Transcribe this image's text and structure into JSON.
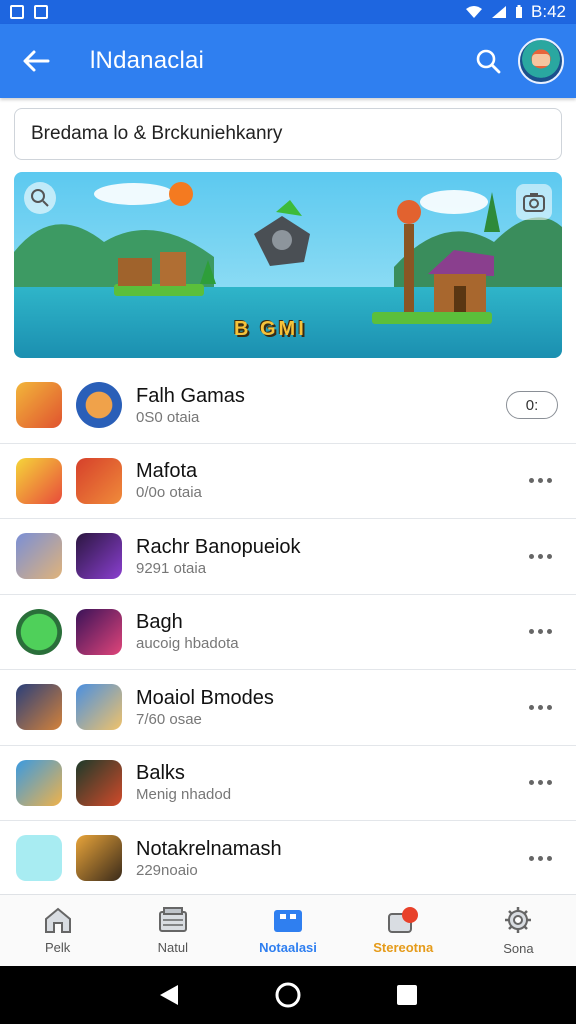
{
  "status_bar": {
    "time": "B:42"
  },
  "app_bar": {
    "title": "lNdanaclai"
  },
  "search": {
    "value": "Bredama lo & Brckuniehkanry"
  },
  "banner": {
    "caption": "B GMI"
  },
  "games": [
    {
      "title": "Falh Gamas",
      "subtitle": "0S0 otaia",
      "action": "pill",
      "action_label": "0:"
    },
    {
      "title": "Mafota",
      "subtitle": "0/0o otaia",
      "action": "more"
    },
    {
      "title": "Rachr Banopueiok",
      "subtitle": "9291 otaia",
      "action": "more"
    },
    {
      "title": "Bagh",
      "subtitle": "aucoig hbadota",
      "action": "more"
    },
    {
      "title": "Moaiol Bmodes",
      "subtitle": "7/60 osae",
      "action": "more"
    },
    {
      "title": "Balks",
      "subtitle": "Menig nhadod",
      "action": "more"
    },
    {
      "title": "Notakrelnamash",
      "subtitle": "229noaio",
      "action": "more"
    }
  ],
  "bottom_nav": [
    {
      "label": "Pelk",
      "icon": "home-icon"
    },
    {
      "label": "Natul",
      "icon": "box-icon"
    },
    {
      "label": "Notaalasi",
      "icon": "store-icon"
    },
    {
      "label": "Stereotna",
      "icon": "notification-icon"
    },
    {
      "label": "Sona",
      "icon": "gear-icon"
    }
  ],
  "colors": {
    "primary": "#2f7ff0",
    "status_bar": "#1e66e0",
    "accent_orange": "#e59b1a"
  }
}
